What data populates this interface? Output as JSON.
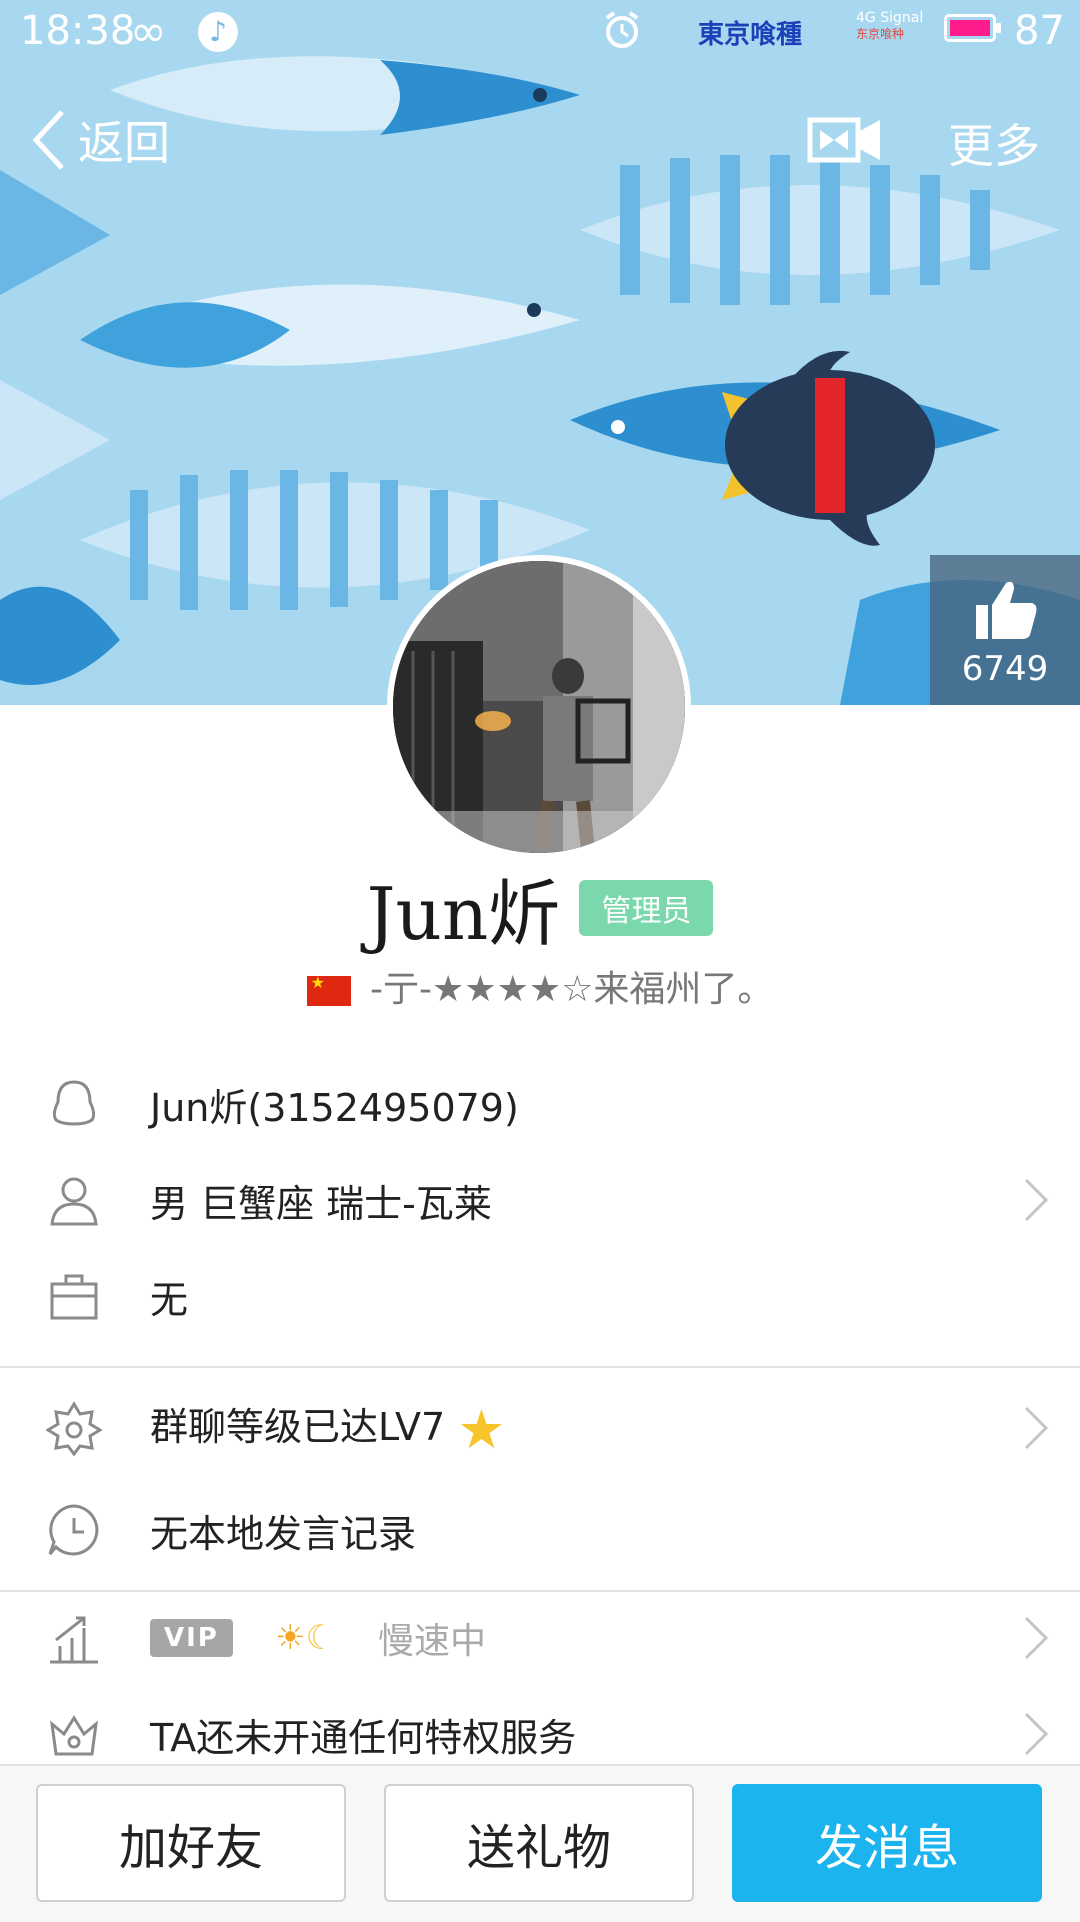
{
  "status_bar": {
    "time": "18:38",
    "carrier": "東京喰種",
    "signal_label": "4G Signal",
    "signal_sub": "东京喰种",
    "battery_level": "87",
    "battery_color": "#ff1d8e"
  },
  "nav": {
    "back_label": "返回",
    "more_label": "更多"
  },
  "like": {
    "count": "6749"
  },
  "profile": {
    "name": "Jun炘",
    "badge": "管理员",
    "signature": "-亍-★★★★☆来福州了。"
  },
  "info": {
    "qq": "Jun炘(3152495079)",
    "personal": "男  巨蟹座  瑞士-瓦莱",
    "job": "无",
    "group_level": "群聊等级已达LV7",
    "speech": "无本地发言记录",
    "vip_tag": "VIP",
    "vip_status": "慢速中",
    "privilege": "TA还未开通任何特权服务"
  },
  "actions": {
    "add_friend": "加好友",
    "send_gift": "送礼物",
    "send_message": "发消息"
  },
  "colors": {
    "primary": "#1bb4ef",
    "badge": "#7bd8ac",
    "cover": "#9fd3ef"
  }
}
